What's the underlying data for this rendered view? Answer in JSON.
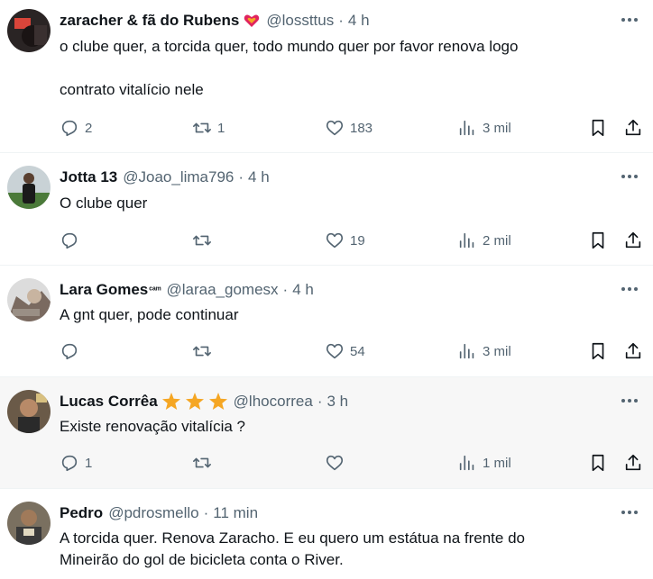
{
  "icons": {
    "reply": "reply-icon",
    "retweet": "retweet-icon",
    "like": "heart-icon",
    "views": "views-icon",
    "bookmark": "bookmark-icon",
    "share": "share-icon",
    "more": "more-icon"
  },
  "colors": {
    "text": "#0f1419",
    "muted": "#536471",
    "divider": "#eff3f4",
    "star": "#f5a623"
  },
  "posts": [
    {
      "name": "zaracher & fã do Rubens",
      "handle": "@lossttus",
      "time": "4 h",
      "lines": [
        "o clube quer, a torcida quer, todo mundo quer por favor renova logo",
        "",
        "contrato vitalício nele"
      ],
      "replies": "2",
      "retweets": "1",
      "likes": "183",
      "views": "3 mil"
    },
    {
      "name": "Jotta 13",
      "handle": "@Joao_lima796",
      "time": "4 h",
      "lines": [
        "O clube quer"
      ],
      "replies": "",
      "retweets": "",
      "likes": "19",
      "views": "2 mil"
    },
    {
      "name": "Lara Gomes",
      "name_suffix": "ᶜᵃᵐ",
      "handle": "@laraa_gomesx",
      "time": "4 h",
      "lines": [
        "A gnt quer, pode continuar"
      ],
      "replies": "",
      "retweets": "",
      "likes": "54",
      "views": "3 mil"
    },
    {
      "name": "Lucas Corrêa",
      "badge": "three-stars-icon",
      "handle": "@lhocorrea",
      "time": "3 h",
      "lines": [
        "Existe renovação vitalícia ?"
      ],
      "replies": "1",
      "retweets": "",
      "likes": "",
      "views": "1 mil"
    },
    {
      "name": "Pedro",
      "handle": "@pdrosmello",
      "time": "11 min",
      "lines": [
        "A torcida quer. Renova Zaracho. E eu quero um estátua na frente do",
        "Mineirão do gol de bicicleta conta o River."
      ]
    }
  ]
}
